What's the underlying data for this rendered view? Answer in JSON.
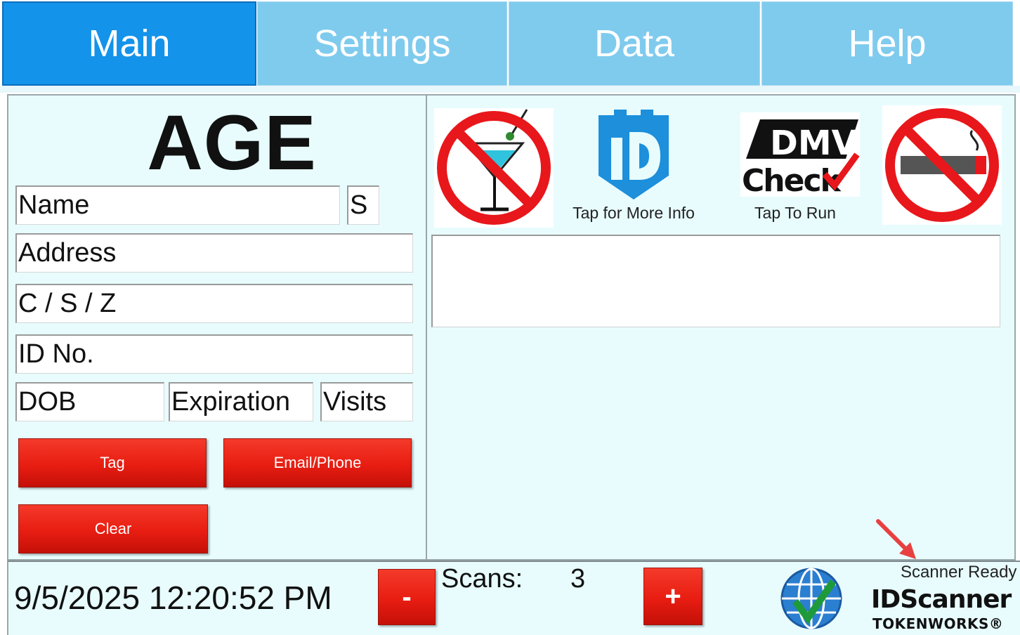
{
  "tabs": [
    {
      "label": "Main",
      "active": true
    },
    {
      "label": "Settings",
      "active": false
    },
    {
      "label": "Data",
      "active": false
    },
    {
      "label": "Help",
      "active": false
    }
  ],
  "id_panel": {
    "title": "AGE",
    "name": "Name",
    "sex": "S",
    "address": "Address",
    "csz": "C / S / Z",
    "id_no": "ID No.",
    "dob": "DOB",
    "expiration": "Expiration",
    "visits": "Visits"
  },
  "buttons": {
    "tag": "Tag",
    "email_phone": "Email/Phone",
    "clear": "Clear",
    "decrement": "-",
    "increment": "+"
  },
  "icons": {
    "no_alcohol": "no-alcohol-icon",
    "id_logo": "id-shield-icon",
    "dmv_check": "dmv-check-logo",
    "no_smoking": "no-smoking-icon",
    "globe": "globe-check-icon"
  },
  "captions": {
    "id_info": "Tap for More Info",
    "dmv_run": "Tap To Run"
  },
  "dmv_logo": {
    "line1": "DMV",
    "line2": "Check"
  },
  "status": {
    "datetime": "9/5/2025 12:20:52 PM",
    "scans_label": "Scans:",
    "scans_count": "3",
    "scanner_state": "Scanner Ready"
  },
  "brand": {
    "id_scanner": "IDScanner",
    "tokenworks": "TOKENWORKS®"
  },
  "colors": {
    "tab_active": "#1493ea",
    "tab_inactive": "#7fcbee",
    "panel_bg": "#e8fcfe",
    "button_red": "#e81d12",
    "prohibit_red": "#e8171b",
    "id_blue": "#1d8fdb"
  }
}
